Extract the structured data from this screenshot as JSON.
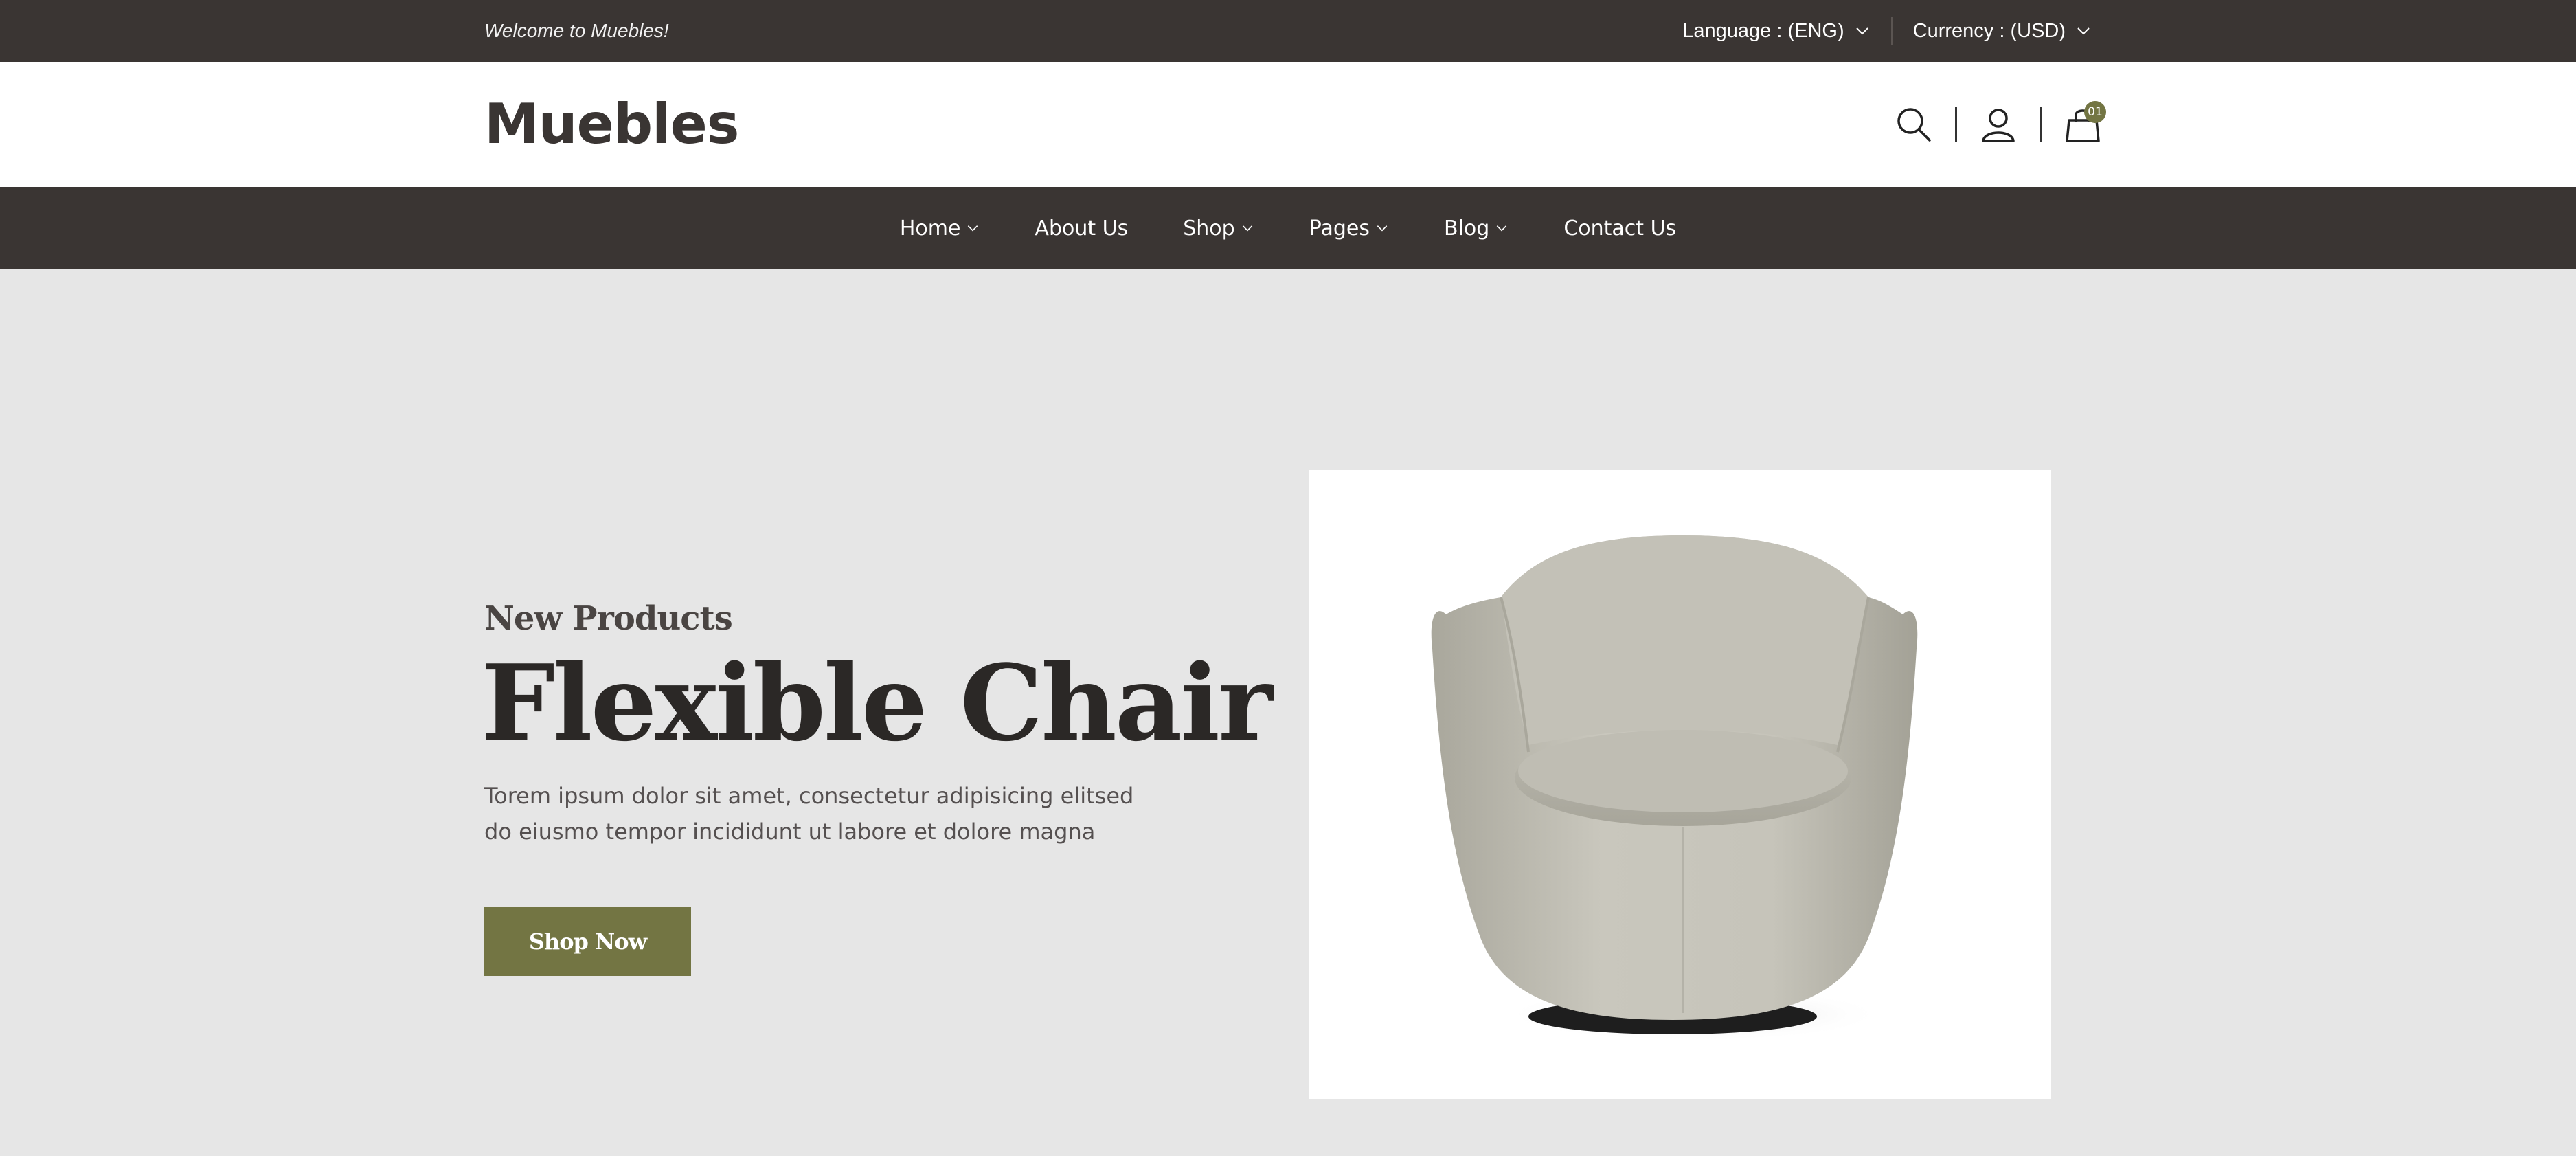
{
  "topbar": {
    "welcome": "Welcome to Muebles!",
    "language_label": "Language : (ENG)",
    "currency_label": "Currency : (USD)"
  },
  "header": {
    "logo": "Muebles",
    "icons": [
      "search-icon",
      "user-icon",
      "cart-icon"
    ],
    "cart_count": "01"
  },
  "nav": {
    "items": [
      {
        "label": "Home",
        "has_dropdown": true
      },
      {
        "label": "About Us",
        "has_dropdown": false
      },
      {
        "label": "Shop",
        "has_dropdown": true
      },
      {
        "label": "Pages",
        "has_dropdown": true
      },
      {
        "label": "Blog",
        "has_dropdown": true
      },
      {
        "label": "Contact Us",
        "has_dropdown": false
      }
    ]
  },
  "hero": {
    "subtitle": "New Products",
    "title": "Flexible Chair",
    "description": "Torem ipsum dolor sit amet, consectetur adipisicing elitsed do eiusmo tempor incididunt ut labore et dolore magna",
    "button_label": "Shop Now",
    "image": "armchair-photo"
  },
  "colors": {
    "dark": "#3a3533",
    "accent": "#737543",
    "hero_bg": "#e6e6e6"
  }
}
